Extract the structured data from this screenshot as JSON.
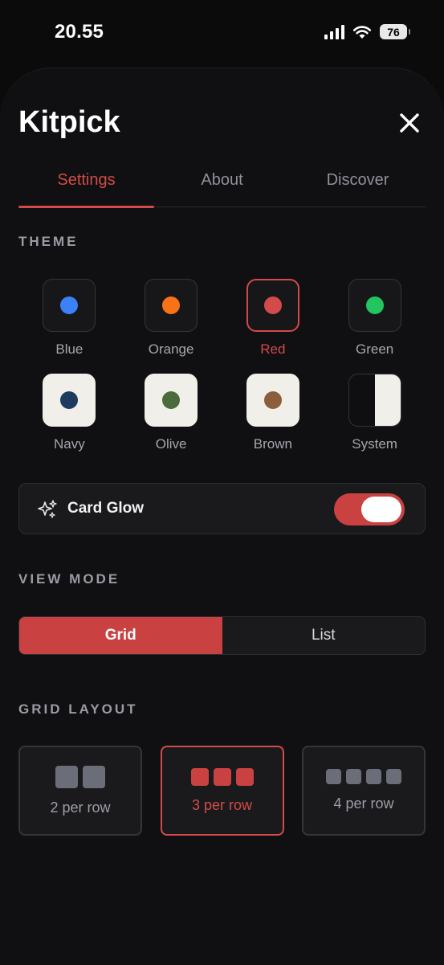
{
  "status_bar": {
    "time": "20.55",
    "battery": "76"
  },
  "app": {
    "title": "Kitpick"
  },
  "tabs": [
    {
      "label": "Settings",
      "active": true
    },
    {
      "label": "About",
      "active": false
    },
    {
      "label": "Discover",
      "active": false
    }
  ],
  "theme": {
    "section_title": "THEME",
    "options": [
      {
        "label": "Blue",
        "color": "#3b82f6",
        "selected": false
      },
      {
        "label": "Orange",
        "color": "#f97316",
        "selected": false
      },
      {
        "label": "Red",
        "color": "#d24a49",
        "selected": true
      },
      {
        "label": "Green",
        "color": "#22c55e",
        "selected": false
      },
      {
        "label": "Navy",
        "color": "#1e3a5f",
        "selected": false
      },
      {
        "label": "Olive",
        "color": "#4a6b3a",
        "selected": false
      },
      {
        "label": "Brown",
        "color": "#8b5e3c",
        "selected": false
      },
      {
        "label": "System",
        "color": "",
        "selected": false
      }
    ]
  },
  "card_glow": {
    "label": "Card Glow",
    "enabled": true,
    "icon": "sparkles-icon"
  },
  "view_mode": {
    "section_title": "VIEW MODE",
    "options": [
      {
        "label": "Grid",
        "active": true
      },
      {
        "label": "List",
        "active": false
      }
    ]
  },
  "grid_layout": {
    "section_title": "GRID LAYOUT",
    "options": [
      {
        "label": "2 per row",
        "active": false
      },
      {
        "label": "3 per row",
        "active": true
      },
      {
        "label": "4 per row",
        "active": false
      }
    ]
  },
  "colors": {
    "accent": "#d24a49",
    "background": "#101012",
    "card": "#1a1a1d"
  }
}
